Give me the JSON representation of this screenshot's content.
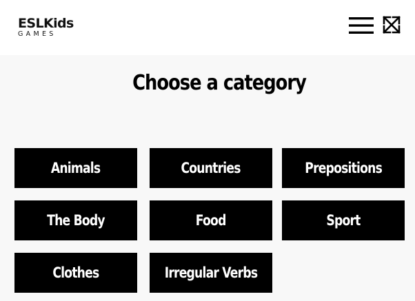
{
  "header": {
    "logo_main": "ESLKids",
    "logo_sub": "GAMES",
    "menu_icon": "hamburger-menu-icon",
    "fullscreen_icon": "expand-arrows-icon"
  },
  "main": {
    "title": "Choose a category",
    "categories": [
      {
        "label": "Animals"
      },
      {
        "label": "Countries"
      },
      {
        "label": "Prepositions"
      },
      {
        "label": "The Body"
      },
      {
        "label": "Food"
      },
      {
        "label": "Sport"
      },
      {
        "label": "Clothes"
      },
      {
        "label": "Irregular Verbs"
      }
    ]
  },
  "colors": {
    "button_bg": "#000000",
    "button_text": "#ffffff",
    "page_bg": "#f8f8f8",
    "header_bg": "#ffffff"
  }
}
